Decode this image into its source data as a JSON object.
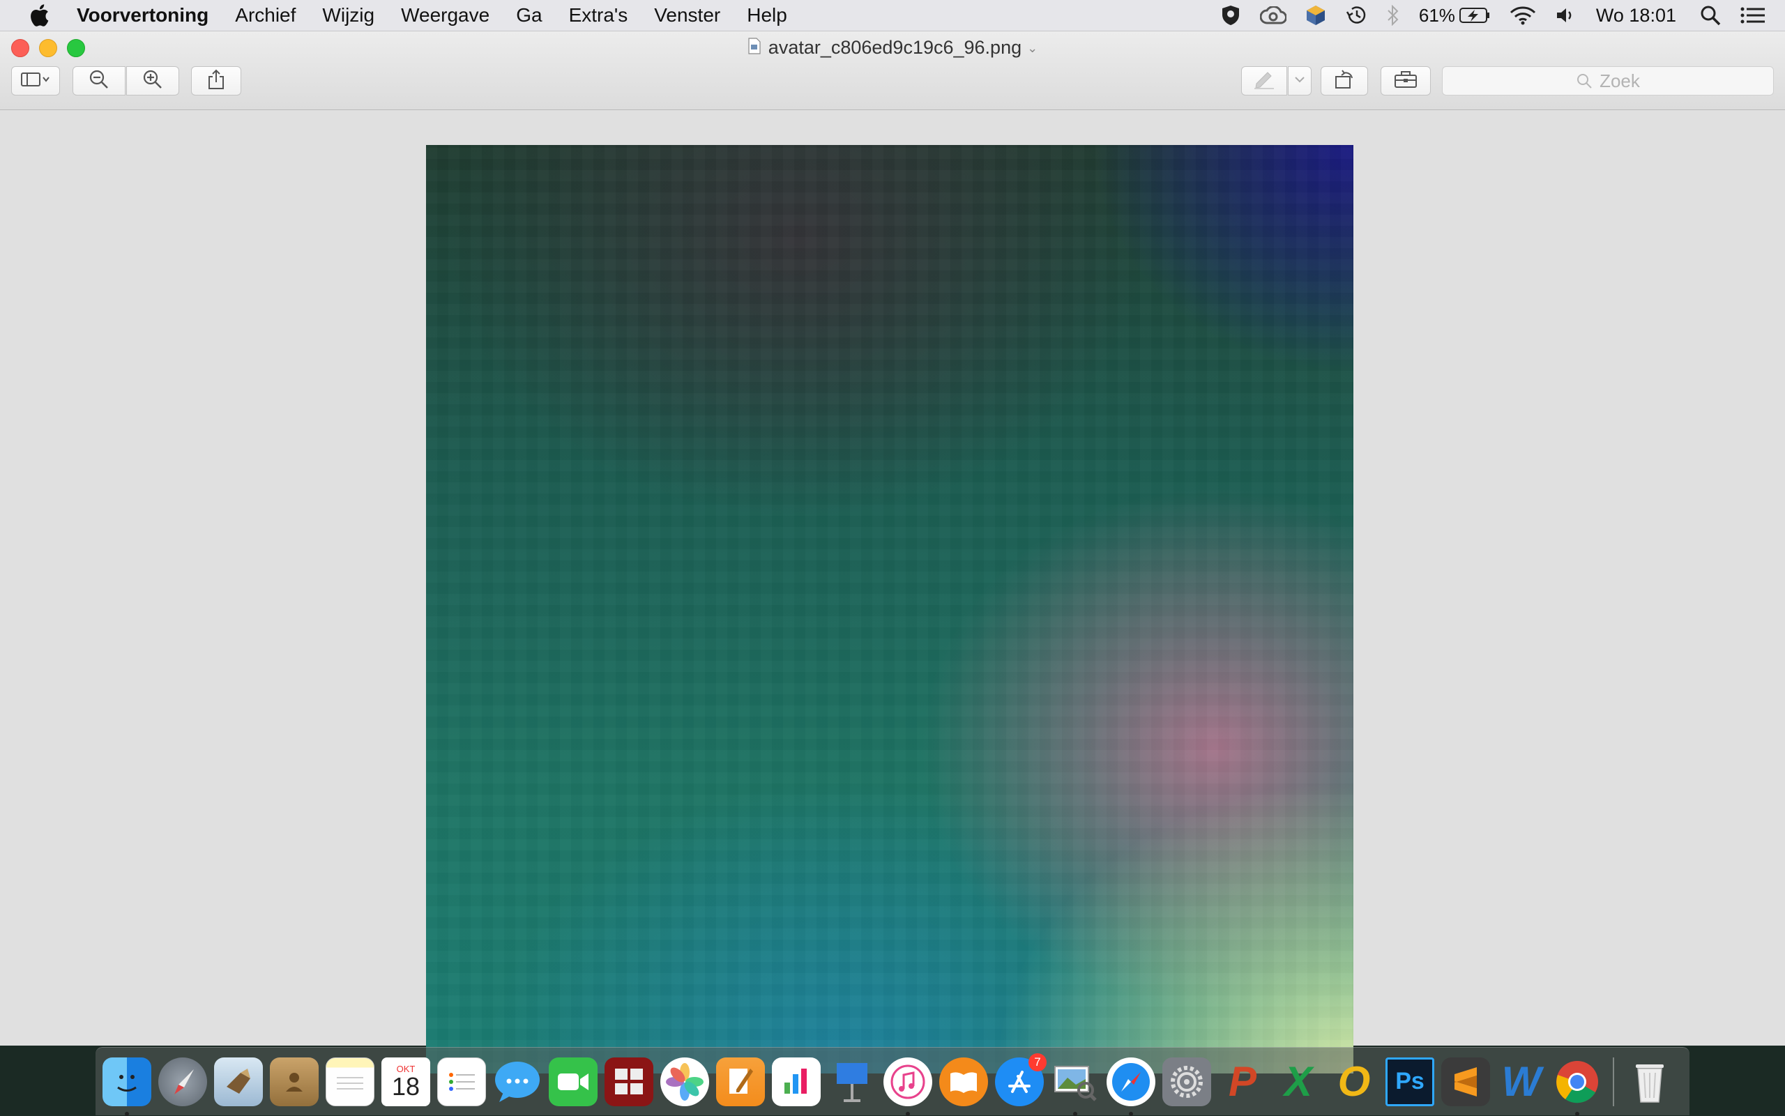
{
  "menubar": {
    "app_name": "Voorvertoning",
    "items": [
      "Archief",
      "Wijzig",
      "Weergave",
      "Ga",
      "Extra's",
      "Venster",
      "Help"
    ],
    "battery_percent": "61%",
    "clock": "Wo 18:01"
  },
  "window": {
    "title": "avatar_c806ed9c19c6_96.png",
    "search_placeholder": "Zoek"
  },
  "dock": {
    "calendar_month": "OKT",
    "calendar_day": "18",
    "app_store_badge": "7",
    "apps": [
      "Finder",
      "Launchpad",
      "Mail",
      "Contacten",
      "Notities",
      "Agenda",
      "Herinneringen",
      "Berichten",
      "FaceTime",
      "Photo Booth",
      "Foto's",
      "Pages",
      "Numbers",
      "Keynote",
      "iTunes",
      "iBooks",
      "App Store",
      "Voorvertoning",
      "Safari",
      "Systeemvoorkeuren",
      "PowerPoint",
      "Excel",
      "Outlook",
      "Photoshop",
      "Sublime Text",
      "Word",
      "Chrome",
      "Prullenmand"
    ]
  },
  "colors": {
    "close": "#fc5f57",
    "minimize": "#fdbc2e",
    "maximize": "#28c840"
  }
}
